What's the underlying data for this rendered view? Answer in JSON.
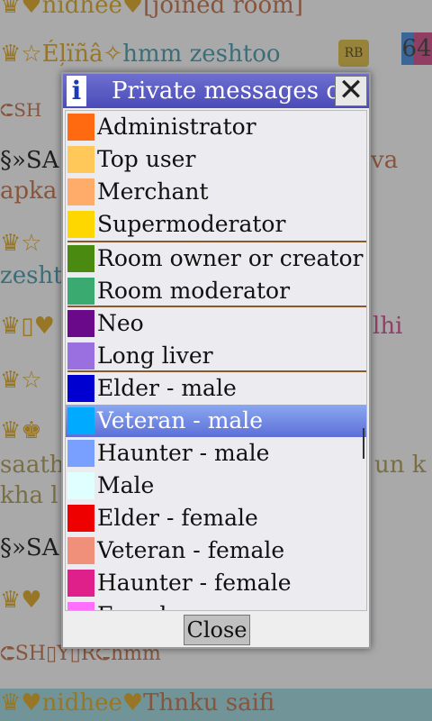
{
  "chat": {
    "lines": [
      {
        "prefix": "♛♥nidhee♥",
        "text": "[joined room]"
      },
      {
        "prefix": "♛☆Éļïñâ✧",
        "text": "hmm zeshtoo"
      },
      {
        "prefix": "⮈SH",
        "text": ""
      },
      {
        "prefix": "§»SA",
        "text": "va"
      },
      {
        "prefix": "apka",
        "text": ""
      },
      {
        "prefix": "♛☆",
        "text": ""
      },
      {
        "prefix": "zesht",
        "text": ""
      },
      {
        "prefix": "♛▯♥",
        "text": "lhi"
      },
      {
        "prefix": "♛☆",
        "text": ""
      },
      {
        "prefix": "♛♚",
        "text": ""
      },
      {
        "prefix": "saath",
        "text": "un k"
      },
      {
        "prefix": " kha l",
        "text": ""
      },
      {
        "prefix": "§»SA",
        "text": ""
      },
      {
        "prefix": "♛♥",
        "text": ""
      },
      {
        "prefix": "⮈SH▯Y▯R⮈",
        "text": "hmm"
      },
      {
        "prefix": "♛♥nidhee♥",
        "text": "Thnku saifi"
      }
    ],
    "badge": "64",
    "emblem": "RB"
  },
  "dialog": {
    "title": "Private messages co",
    "close_x": "✕",
    "close_label": "Close",
    "items": [
      {
        "label": "Administrator",
        "color": "#ff6a10"
      },
      {
        "label": "Top user",
        "color": "#ffc858"
      },
      {
        "label": "Merchant",
        "color": "#ffab6a"
      },
      {
        "label": "Supermoderator",
        "color": "#ffd700"
      },
      {
        "label": "Room owner or creator",
        "color": "#4a8a10"
      },
      {
        "label": "Room moderator",
        "color": "#3aaa70"
      },
      {
        "label": "Neo",
        "color": "#6a0a8a"
      },
      {
        "label": "Long liver",
        "color": "#9a70e0"
      },
      {
        "label": "Elder - male",
        "color": "#0000d0"
      },
      {
        "label": "Veteran - male",
        "color": "#00aaff"
      },
      {
        "label": "Haunter - male",
        "color": "#7aa0ff"
      },
      {
        "label": "Male",
        "color": "#e0ffff"
      },
      {
        "label": "Elder - female",
        "color": "#ee0000"
      },
      {
        "label": "Veteran - female",
        "color": "#f0907a"
      },
      {
        "label": "Haunter - female",
        "color": "#e0208a"
      },
      {
        "label": "Female",
        "color": "#ff70ff"
      }
    ],
    "selected_label": "Veteran - male"
  }
}
